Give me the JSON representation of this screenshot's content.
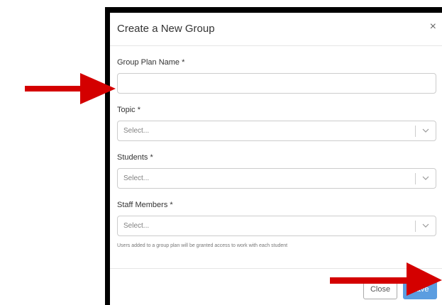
{
  "modal": {
    "title": "Create a New Group",
    "close_glyph": "×"
  },
  "form": {
    "group_plan_name": {
      "label": "Group Plan Name *",
      "value": ""
    },
    "topic": {
      "label": "Topic *",
      "placeholder": "Select..."
    },
    "students": {
      "label": "Students *",
      "placeholder": "Select..."
    },
    "staff_members": {
      "label": "Staff Members *",
      "placeholder": "Select..."
    },
    "help_text": "Users added to a group plan will be granted access to work with each student"
  },
  "footer": {
    "close_label": "Close",
    "save_label": "Save"
  },
  "annotations": {
    "arrow_color": "#d40000",
    "icons": [
      "close-icon",
      "chevron-down-icon",
      "arrow-annotation"
    ]
  }
}
